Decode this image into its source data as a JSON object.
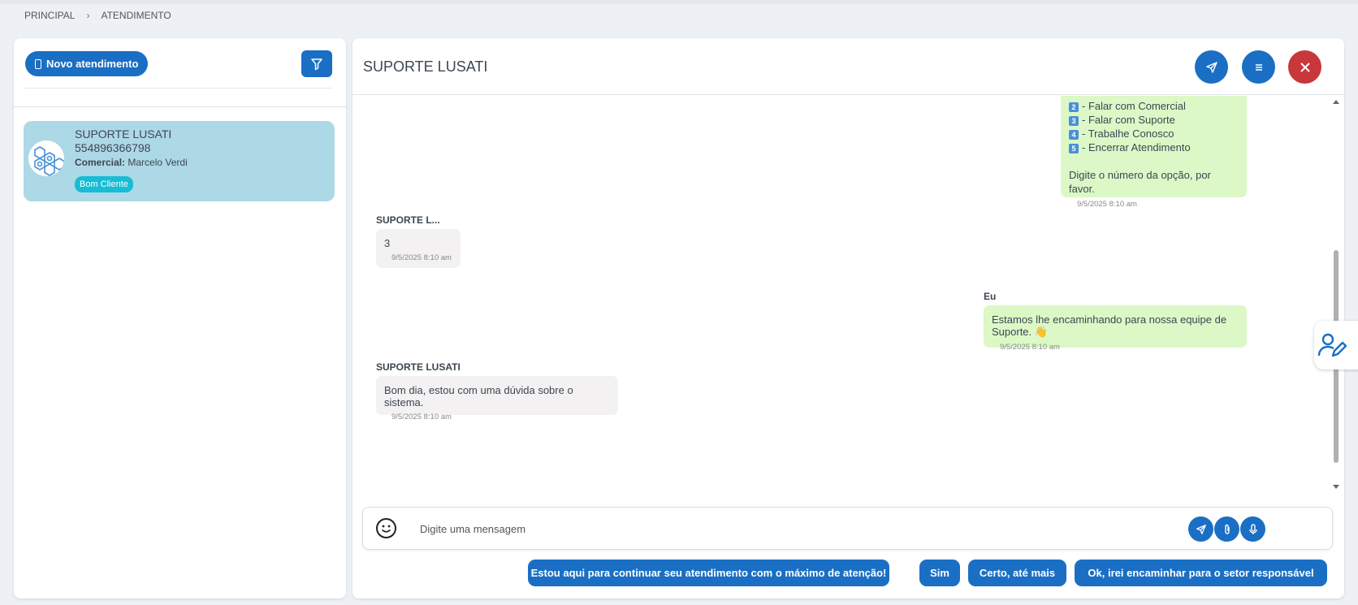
{
  "breadcrumb": {
    "home": "PRINCIPAL",
    "current": "ATENDIMENTO"
  },
  "sidebar": {
    "new_button": "Novo atendimento",
    "filter_icon": "filter-icon",
    "contacts": [
      {
        "name": "SUPORTE LUSATI",
        "phone": "554896366798",
        "commercial_label": "Comercial:",
        "commercial_value": "Marcelo Verdi",
        "badge": "Bom Cliente"
      }
    ]
  },
  "chat": {
    "title": "SUPORTE LUSATI",
    "header_icons": [
      "send-icon",
      "menu-icon",
      "close-icon"
    ],
    "menu_message": {
      "options": [
        {
          "num": "2",
          "text": "- Falar com Comercial"
        },
        {
          "num": "3",
          "text": "- Falar com Suporte"
        },
        {
          "num": "4",
          "text": "- Trabalhe Conosco"
        },
        {
          "num": "5",
          "text": "- Encerrar Atendimento"
        }
      ],
      "footer": "Digite o número da opção, por favor.",
      "timestamp": "9/5/2025 8:10 am"
    },
    "messages": [
      {
        "sender": "SUPORTE L...",
        "text": "3",
        "timestamp": "9/5/2025 8:10 am",
        "direction": "in"
      },
      {
        "sender": "Eu",
        "text": "Estamos lhe encaminhando para nossa equipe de Suporte. 👋",
        "timestamp": "9/5/2025 8:10 am",
        "direction": "out"
      },
      {
        "sender": "SUPORTE LUSATI",
        "text": "Bom dia, estou com uma dúvida sobre o sistema.",
        "timestamp": "9/5/2025 8:10 am",
        "direction": "in"
      }
    ],
    "composer": {
      "placeholder": "Digite uma mensagem"
    },
    "quick_replies": [
      "Estou aqui para continuar seu atendimento com o máximo de atenção!",
      "Sim",
      "Certo, até mais",
      "Ok, irei encaminhar para o setor responsável"
    ]
  },
  "colors": {
    "primary": "#1a6fc4",
    "danger": "#c8373a",
    "outgoing": "#dcf8c6",
    "incoming": "#f3f1f1",
    "selected_contact": "#add8e6",
    "badge": "#17bcd6"
  }
}
